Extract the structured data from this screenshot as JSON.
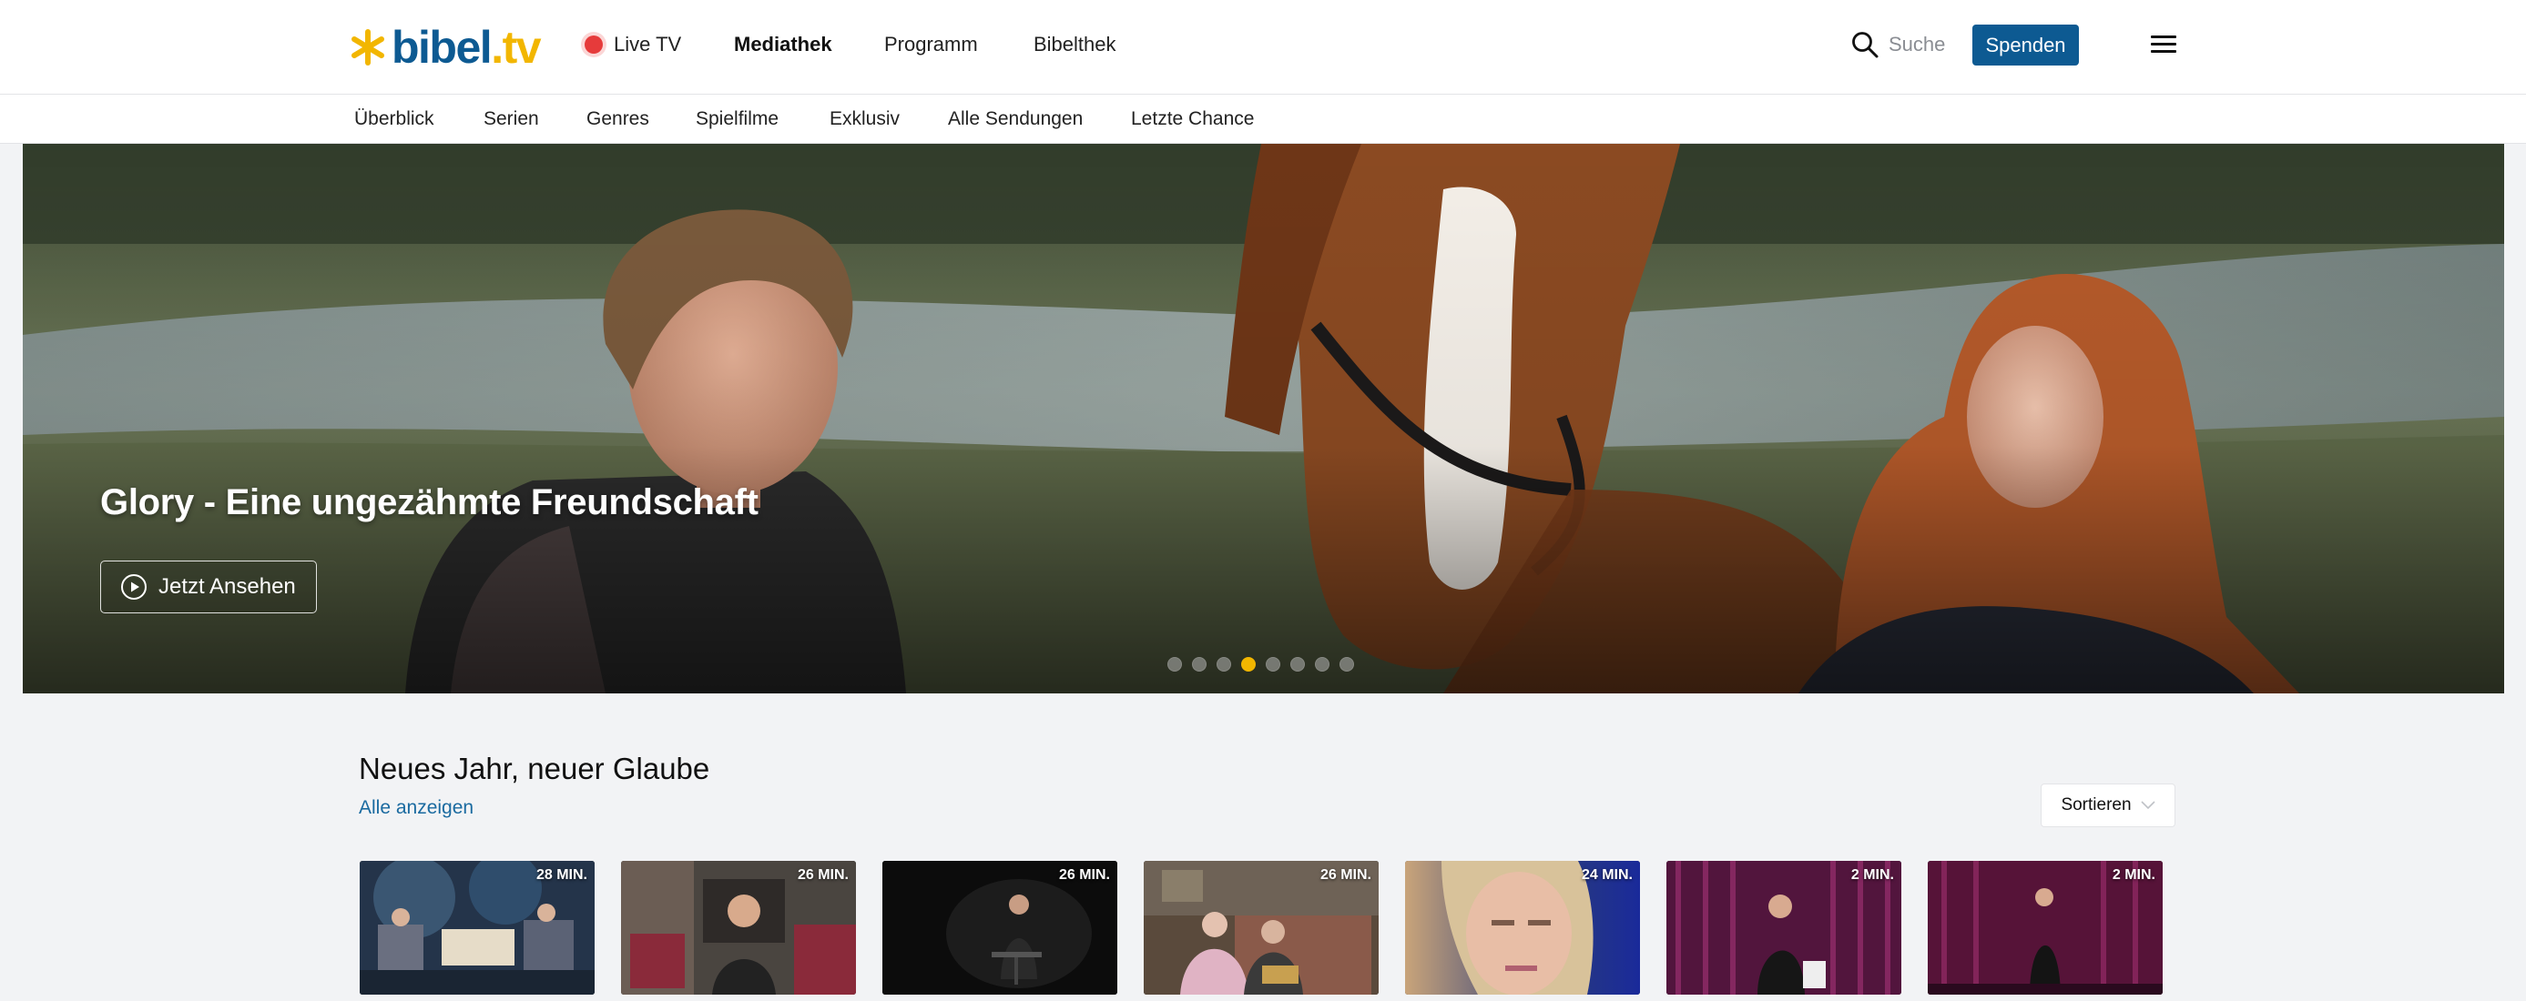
{
  "brand": {
    "name": "bibel",
    "tld": ".tv"
  },
  "header": {
    "live_label": "Live TV",
    "nav": [
      "Mediathek",
      "Programm",
      "Bibelthek"
    ],
    "search_placeholder": "Suche",
    "donate_label": "Spenden"
  },
  "subnav": [
    "Überblick",
    "Serien",
    "Genres",
    "Spielfilme",
    "Exklusiv",
    "Alle Sendungen",
    "Letzte Chance"
  ],
  "hero": {
    "title": "Glory - Eine ungezähmte Freundschaft",
    "cta_label": "Jetzt Ansehen",
    "slide_count": 8,
    "active_slide": 4
  },
  "section": {
    "title": "Neues Jahr, neuer Glaube",
    "link_label": "Alle anzeigen",
    "sort_label": "Sortieren",
    "cards": [
      {
        "duration": "28 MIN."
      },
      {
        "duration": "26 MIN."
      },
      {
        "duration": "26 MIN."
      },
      {
        "duration": "26 MIN."
      },
      {
        "duration": "24 MIN."
      },
      {
        "duration": "2 MIN."
      },
      {
        "duration": "2 MIN."
      }
    ]
  },
  "colors": {
    "brand_blue": "#0d5a92",
    "brand_yellow": "#f2b600",
    "live_red": "#e63b3b",
    "link_blue": "#1a6aa0"
  }
}
